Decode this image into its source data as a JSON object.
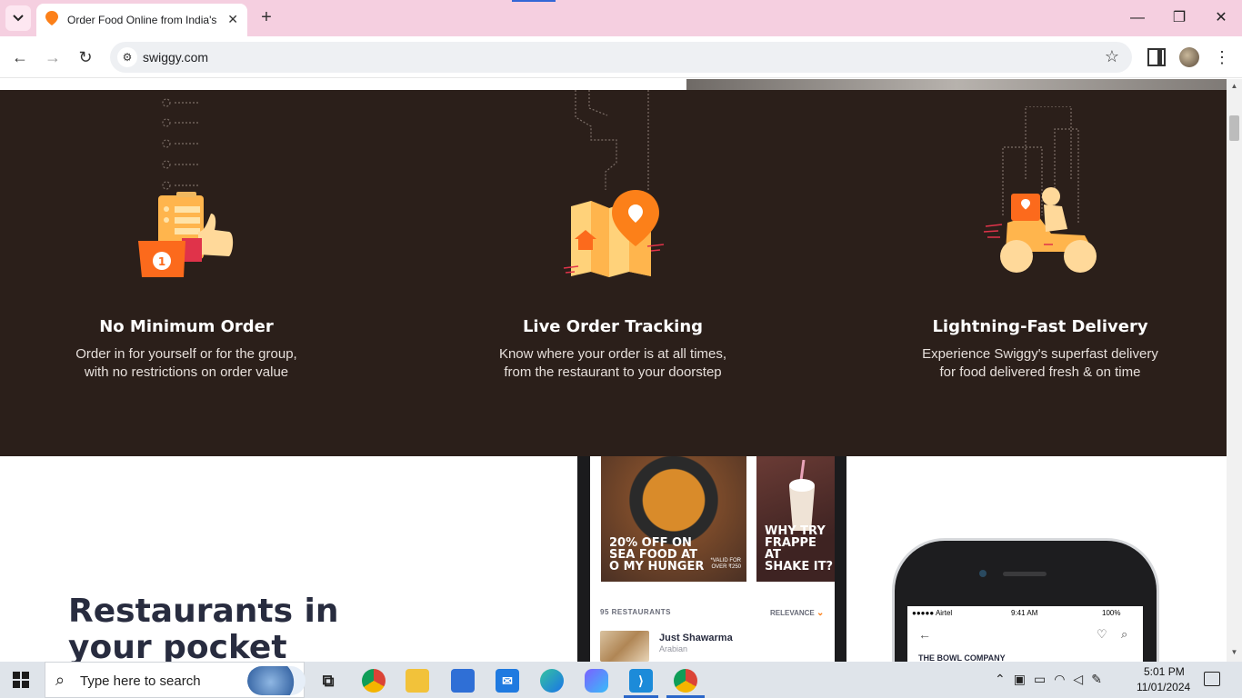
{
  "browser": {
    "tab": {
      "title": "Order Food Online from India's",
      "favicon": "swiggy-icon"
    },
    "url": "swiggy.com",
    "icons": [
      "tab-list-icon",
      "close-icon",
      "plus-icon",
      "minimize-icon",
      "restore-icon",
      "back-icon",
      "forward-icon",
      "reload-icon",
      "site-settings-icon",
      "star-icon",
      "side-panel-icon",
      "profile-avatar",
      "menu-icon"
    ]
  },
  "features": [
    {
      "title": "No Minimum Order",
      "line1": "Order in for yourself or for the group,",
      "line2": "with no restrictions on order value"
    },
    {
      "title": "Live Order Tracking",
      "line1": "Know where your order is at all times,",
      "line2": "from the restaurant to your doorstep"
    },
    {
      "title": "Lightning-Fast Delivery",
      "line1": "Experience Swiggy's superfast delivery",
      "line2": "for food delivered fresh & on time"
    }
  ],
  "section": {
    "headline_line1": "Restaurants in",
    "headline_line2": "your pocket"
  },
  "phone1": {
    "promo1": {
      "line1": "20% OFF ON",
      "line2": "SEA FOOD AT",
      "line3": "O MY HUNGER",
      "note1": "*VALID FOR",
      "note2": "OVER ₹250"
    },
    "promo2": {
      "line1": "WHY TRY",
      "line2": "FRAPPE AT",
      "line3": "SHAKE IT?"
    },
    "restaurants_count": "95 RESTAURANTS",
    "sort_label": "RELEVANCE",
    "restaurant": {
      "name": "Just Shawarma",
      "cuisine": "Arabian"
    }
  },
  "phone2": {
    "carrier": "●●●●● Airtel",
    "time": "9:41 AM",
    "battery": "100%",
    "brand": "THE BOWL COMPANY"
  },
  "taskbar": {
    "search_placeholder": "Type here to search",
    "time": "5:01 PM",
    "date": "11/01/2024",
    "apps": [
      "task-view",
      "chrome",
      "file-explorer",
      "microsoft-store",
      "mail",
      "edge",
      "copilot",
      "vscode",
      "chrome-active"
    ]
  },
  "colors": {
    "dark_section": "#2b1f1a",
    "swiggy_orange": "#fc8019",
    "illustration_yellow": "#ffd27a"
  }
}
